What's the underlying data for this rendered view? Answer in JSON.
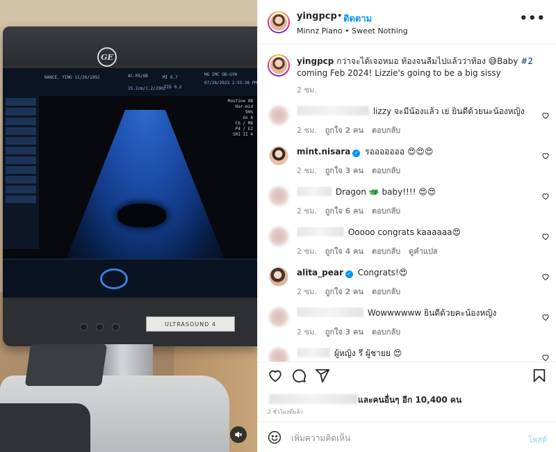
{
  "media": {
    "ultrasound_label": "ULTRASOUND 4",
    "brand": "GE"
  },
  "header": {
    "username": "yingpcp",
    "separator": "•",
    "follow_label": "ติดตาม",
    "music": "Minnz Piano • Sweet Nothing",
    "more": "•••"
  },
  "caption": {
    "username": "yingpcp",
    "text_before": " กว่าจะได้เจอหมอ ท้องจนลืมไปแล้วว่าท้อง 😅Baby ",
    "hashtag": "#2",
    "text_after": " coming Feb 2024! Lizzie's going to be a big sissy",
    "time": "2 ชม."
  },
  "comments": [
    {
      "name": "",
      "text": "lizzy จะมีน้องแล้ว เย่ ยินดีด้วยนะน้องหญิง",
      "time": "2 ชม.",
      "likes": "ถูกใจ 2 คน",
      "reply": "ตอบกลับ",
      "translate": ""
    },
    {
      "name": "mint.nisara",
      "text": "รอออออออ 😍😍😍",
      "time": "2 ชม.",
      "likes": "ถูกใจ 3 คน",
      "reply": "ตอบกลับ",
      "translate": ""
    },
    {
      "name": "",
      "text": "Dragon 🐲 baby!!!! 😍😍",
      "time": "2 ชม.",
      "likes": "ถูกใจ 6 คน",
      "reply": "ตอบกลับ",
      "translate": ""
    },
    {
      "name": "",
      "text": "Ooooo congrats kaaaaaa😍",
      "time": "2 ชม.",
      "likes": "ถูกใจ 4 คน",
      "reply": "ตอบกลับ",
      "translate": "ดูคำแปล"
    },
    {
      "name": "alita_pear",
      "text": "Congrats!😍",
      "time": "2 ชม.",
      "likes": "ถูกใจ 2 คน",
      "reply": "ตอบกลับ",
      "translate": ""
    },
    {
      "name": "",
      "text": "Wowwwwww ยินดีด้วยคะน้องหญิง",
      "time": "2 ชม.",
      "likes": "ถูกใจ 3 คน",
      "reply": "ตอบกลับ",
      "translate": ""
    },
    {
      "name": "",
      "text": "ผู้หญิง รึ ผู้ชายย 😍",
      "time": "",
      "likes": "",
      "reply": "",
      "translate": ""
    }
  ],
  "likes": {
    "text": "และคนอื่นๆ อีก 10,400 คน"
  },
  "posted_time": "2 ชั่วโมงที่แล้ว",
  "add_comment": {
    "placeholder": "เพิ่มความคิดเห็น",
    "post_label": "โพสต์"
  },
  "colors": {
    "accent": "#0095f6",
    "muted": "#8e8e8e",
    "text": "#262626"
  }
}
